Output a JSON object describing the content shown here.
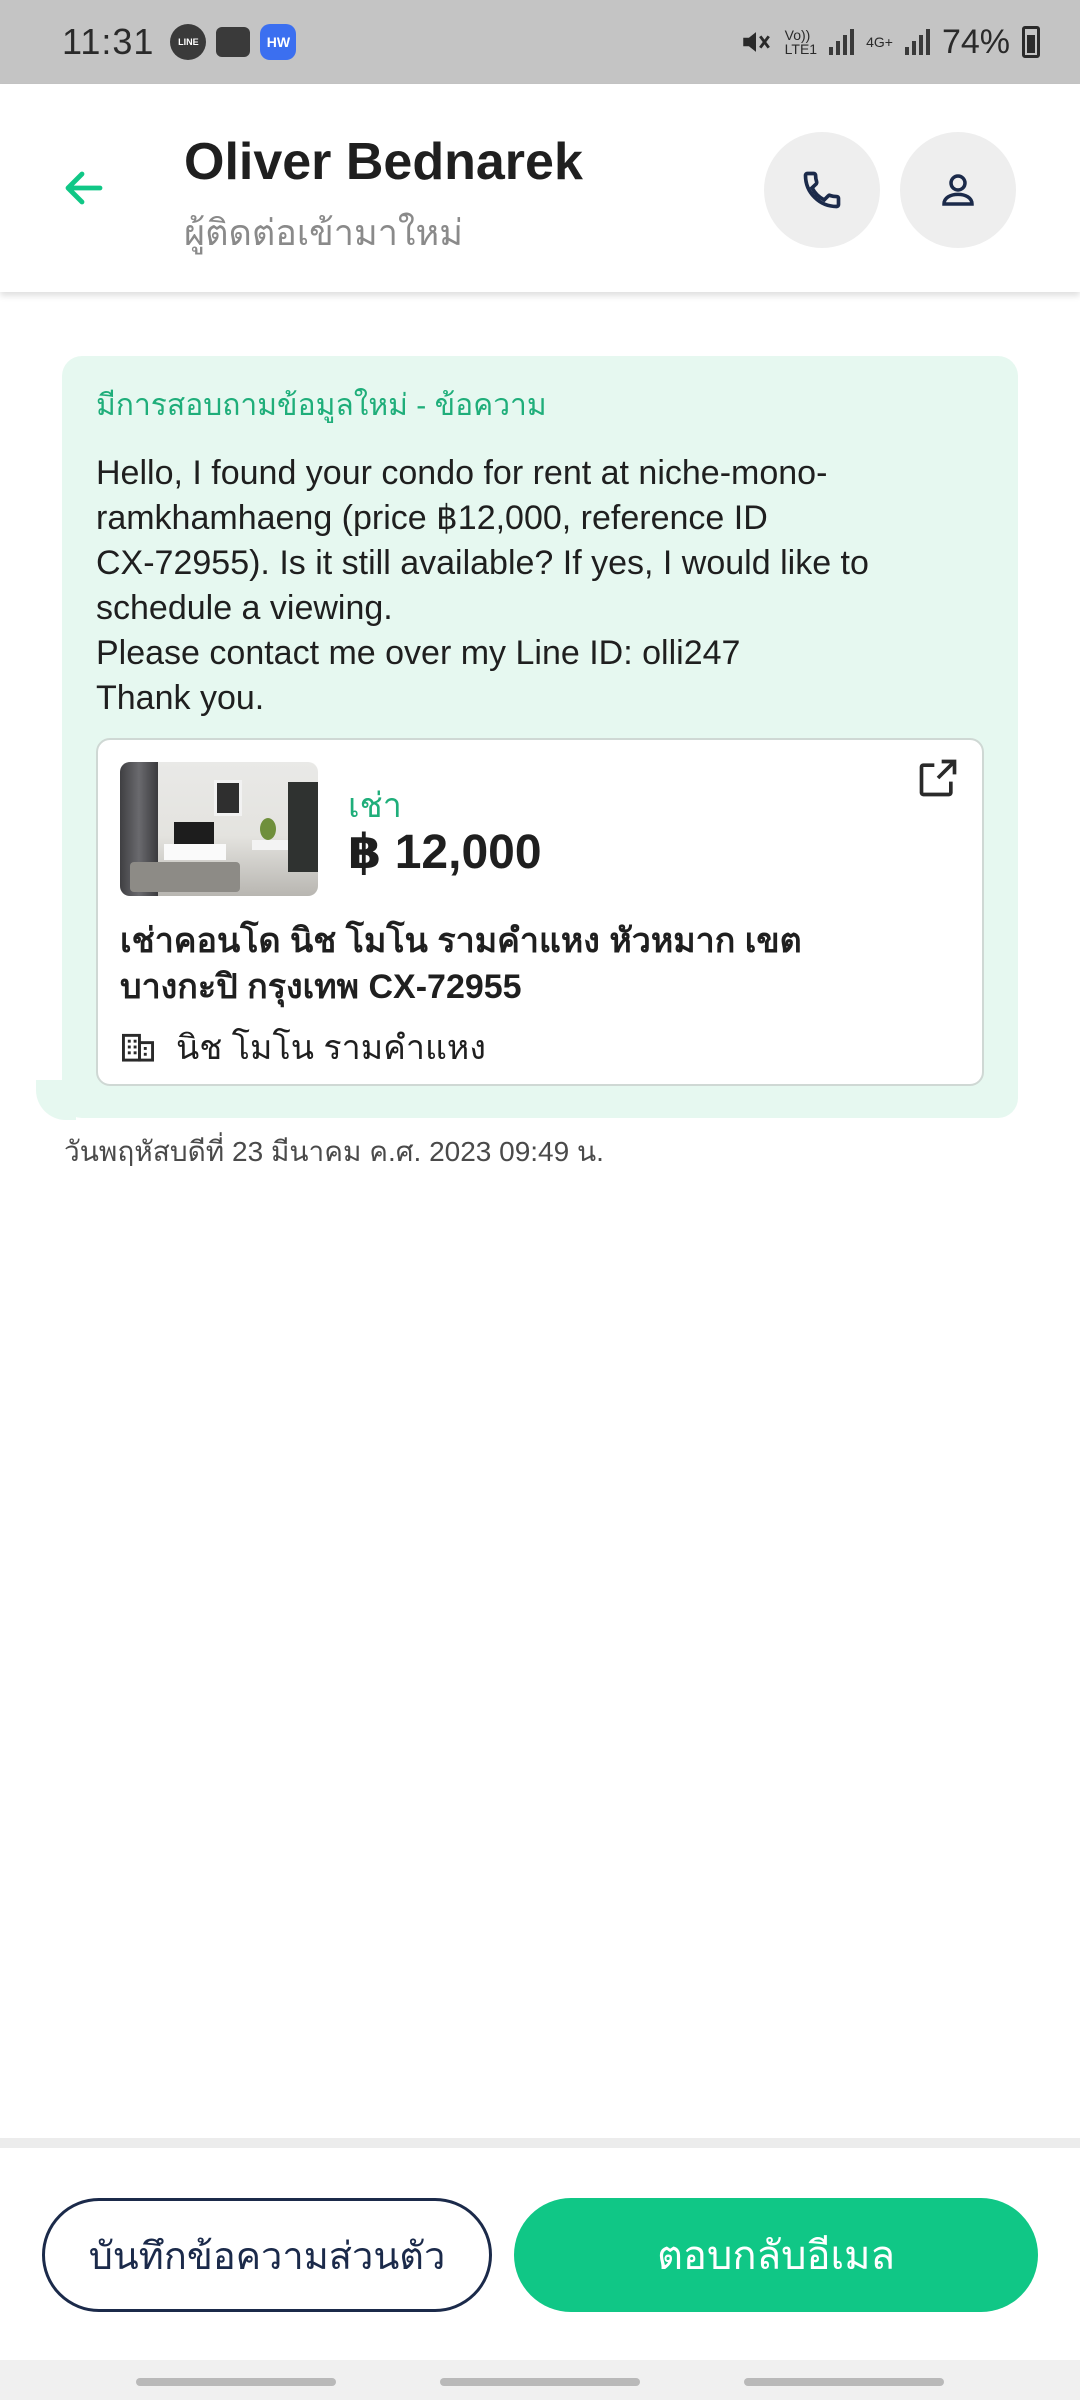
{
  "status_bar": {
    "time": "11:31",
    "line_badge": "LINE",
    "hw_badge": "HW",
    "volte": "Vo))",
    "lte": "LTE1",
    "network": "4G+",
    "battery": "74%"
  },
  "header": {
    "name": "Oliver Bednarek",
    "subtitle": "ผู้ติดต่อเข้ามาใหม่"
  },
  "message": {
    "title": "มีการสอบถามข้อมูลใหม่ - ข้อความ",
    "lines": [
      "Hello, I found your condo for rent at niche-mono-",
      "ramkhamhaeng (price ฿12,000, reference ID",
      "CX-72955). Is it still available? If yes, I would like to",
      "schedule a viewing.",
      "Please contact me over my Line ID: olli247",
      "Thank you."
    ],
    "listing": {
      "type": "เช่า",
      "price": "฿ 12,000",
      "title_line1": "เช่าคอนโด  นิช โมโน รามคำแหง หัวหมาก เขต",
      "title_line2": "บางกะปิ กรุงเทพ CX-72955",
      "project": "นิช โมโน รามคำแหง"
    },
    "timestamp": "วันพฤหัสบดีที่ 23 มีนาคม ค.ศ. 2023 09:49 น."
  },
  "actions": {
    "note_label": "บันทึกข้อความส่วนตัว",
    "reply_label": "ตอบกลับอีเมล"
  },
  "colors": {
    "accent": "#10c786",
    "bubble": "#e6f8f0",
    "title_green": "#1fae7a"
  }
}
